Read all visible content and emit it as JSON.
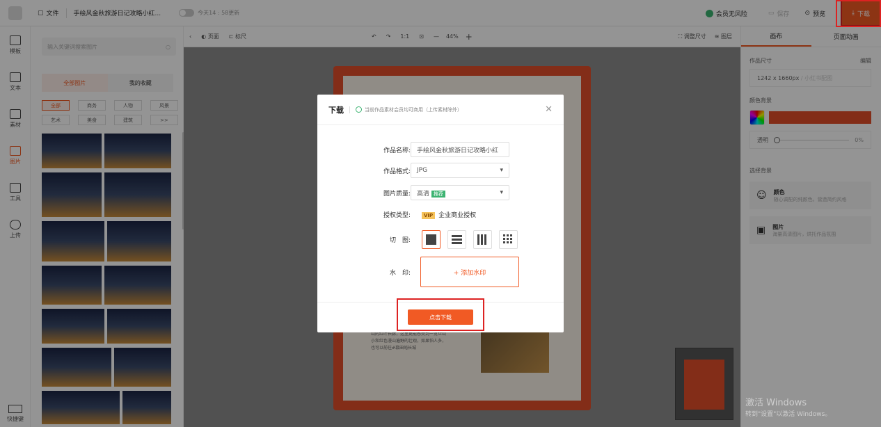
{
  "topbar": {
    "file_label": "文件",
    "doc_title": "手绘风金秋旅游日记攻略小红...",
    "save_time": "今天14 : 58更新",
    "member_safe": "会员无风险",
    "save": "保存",
    "preview": "预览",
    "download": "下载"
  },
  "nav": {
    "items": [
      {
        "label": "模板"
      },
      {
        "label": "文本"
      },
      {
        "label": "素材"
      },
      {
        "label": "图片"
      },
      {
        "label": "工具"
      },
      {
        "label": "上传"
      }
    ],
    "bottom": "快捷键"
  },
  "panel": {
    "search_placeholder": "输入关键词搜索图片",
    "tabs": [
      "全部图片",
      "我的收藏"
    ],
    "cats": [
      "全部",
      "商务",
      "人物",
      "风景",
      "艺术",
      "美食",
      "建筑",
      ">>"
    ]
  },
  "canvasbar": {
    "page": "页面",
    "ruler": "标尺",
    "ratio": "1:1",
    "zoom": "44%",
    "resize": "调整尺寸",
    "layers": "图层"
  },
  "card": {
    "text": "相传《丑月日石图记》，天下奇景之一，长城两侧分布着5000余棵红叶。相比香山的红叶长廊，这里更能感受到一览众山小和红色漫山遍野的壮观，如果怕人多，也可以前往#慕田峪长城"
  },
  "right": {
    "tabs": [
      "画布",
      "页面动画"
    ],
    "size_label": "作品尺寸",
    "edit": "编辑",
    "size_value": "1242 x 1660px",
    "size_hint": "/ 小红书配图",
    "color_bg": "颜色背景",
    "opacity": "透明",
    "opacity_val": "0%",
    "select_bg": "选择背景",
    "opt1_title": "颜色",
    "opt1_desc": "随心调配的纯颜色，营造简约风格",
    "opt2_title": "图片",
    "opt2_desc": "海量高清图片，烘托作品氛围"
  },
  "modal": {
    "title": "下载",
    "note": "当前作品素材会员均可商用（上传素材除外）",
    "name_label": "作品名称:",
    "name_value": "手绘风金秋旅游日记攻略小红",
    "format_label": "作品格式:",
    "format_value": "JPG",
    "quality_label": "图片质量:",
    "quality_value": "高清",
    "quality_tag": "推荐",
    "license_label": "授权类型:",
    "license_vip": "VIP",
    "license_value": "企业商业授权",
    "cut_label": "切　图:",
    "wm_label": "水　印:",
    "wm_button": "+ 添加水印",
    "download_button": "点击下载"
  },
  "windows": {
    "title": "激活 Windows",
    "sub": "转到\"设置\"以激活 Windows。"
  },
  "colors": {
    "accent": "#f15a24",
    "card": "#e24f2a"
  }
}
